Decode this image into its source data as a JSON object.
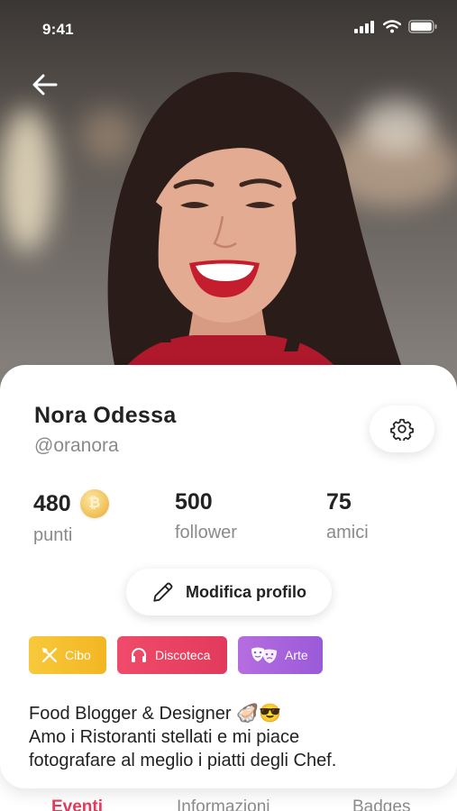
{
  "status_bar": {
    "time": "9:41"
  },
  "profile": {
    "name": "Nora Odessa",
    "handle": "@oranora",
    "stats": [
      {
        "value": "480",
        "label": "punti"
      },
      {
        "value": "500",
        "label": "follower"
      },
      {
        "value": "75",
        "label": "amici"
      }
    ],
    "edit_label": "Modifica profilo",
    "tags": [
      {
        "label": "Cibo",
        "icon": "fork-knife-icon",
        "color": "#f5c230"
      },
      {
        "label": "Discoteca",
        "icon": "headphones-icon",
        "color": "#e8435f"
      },
      {
        "label": "Arte",
        "icon": "theater-masks-icon",
        "color": "#a863dc"
      }
    ],
    "bio": [
      "Food Blogger & Designer 🦪😎",
      "Amo i Ristoranti stellati e mi piace",
      "fotografare al meglio i piatti degli Chef."
    ]
  },
  "tabs": [
    {
      "label": "Eventi",
      "active": true
    },
    {
      "label": "Informazioni",
      "active": false
    },
    {
      "label": "Badges",
      "active": false
    }
  ],
  "colors": {
    "accent": "#e23a5c",
    "text": "#222222",
    "muted": "#8a8a8a"
  }
}
